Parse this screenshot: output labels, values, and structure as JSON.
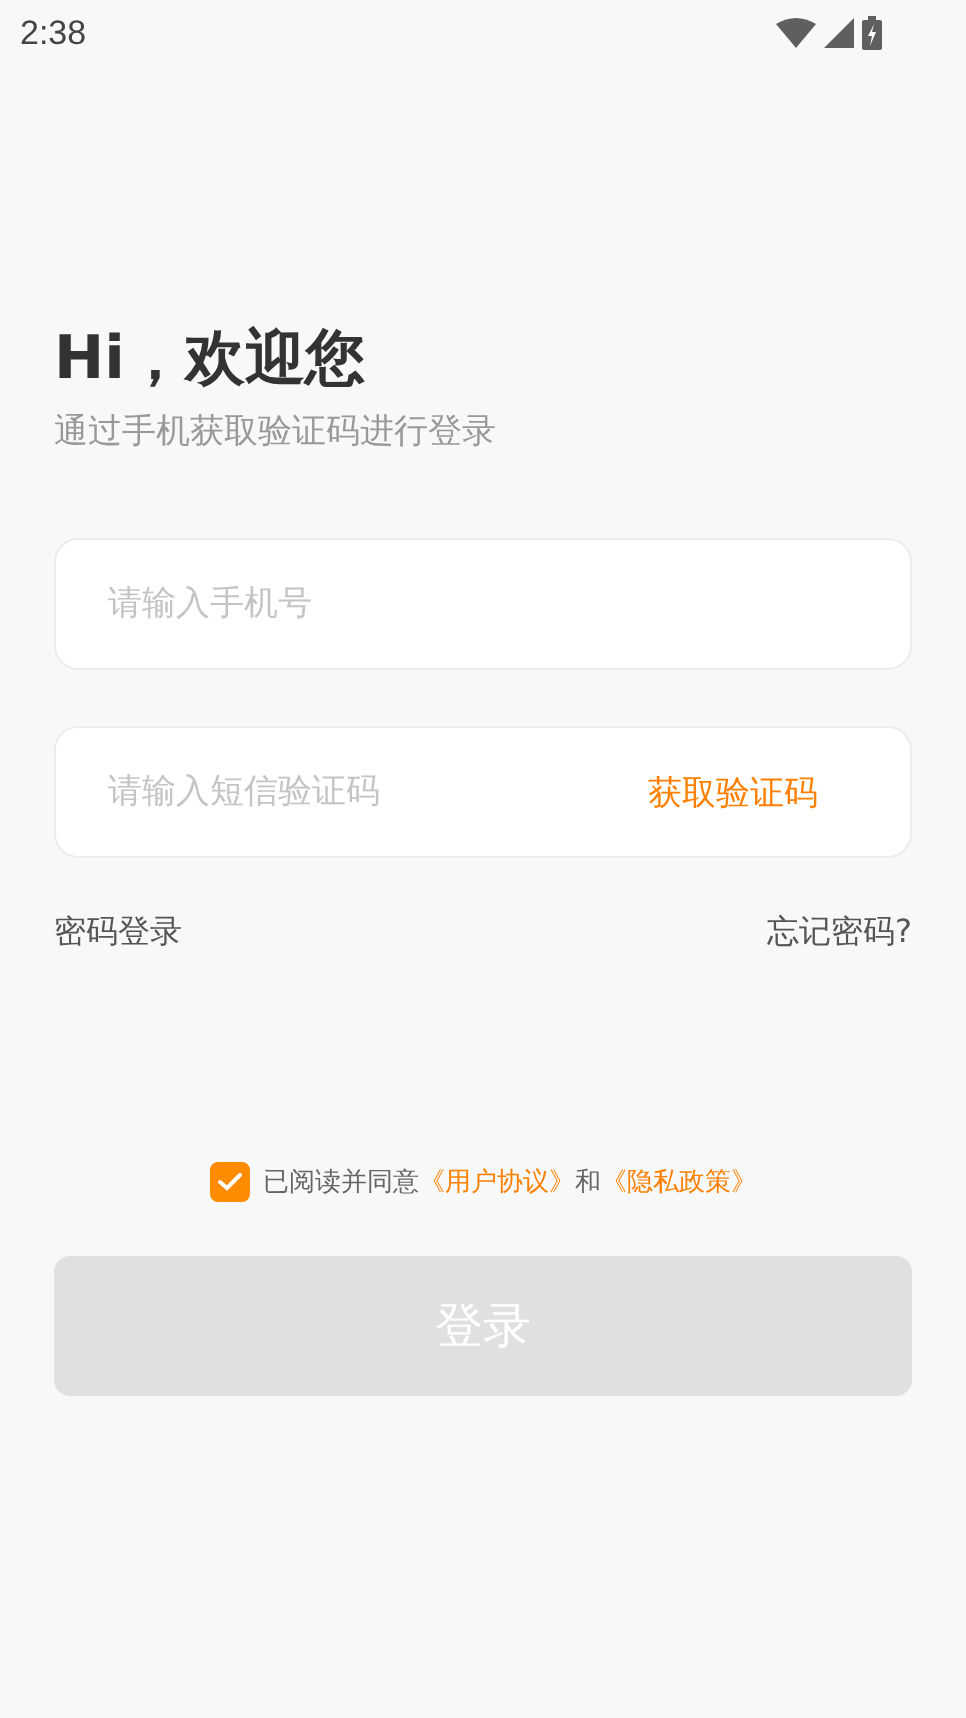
{
  "status_bar": {
    "time": "2:38"
  },
  "heading": {
    "title": "Hi，欢迎您",
    "subtitle": "通过手机获取验证码进行登录"
  },
  "phone_field": {
    "placeholder": "请输入手机号"
  },
  "code_field": {
    "placeholder": "请输入短信验证码",
    "action": "获取验证码"
  },
  "links": {
    "password_login": "密码登录",
    "forgot_password": "忘记密码?"
  },
  "agreement": {
    "checked": true,
    "prefix": "已阅读并同意",
    "terms_link": "《用户协议》",
    "conjunction": "和",
    "privacy_link": "《隐私政策》"
  },
  "login_button": {
    "label": "登录",
    "disabled": true
  }
}
